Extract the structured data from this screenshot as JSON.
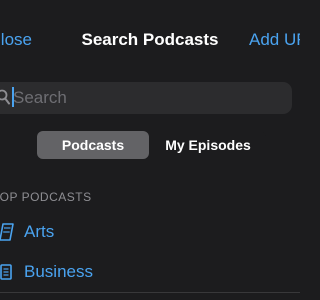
{
  "navbar": {
    "left_label": "Close",
    "title": "Search Podcasts",
    "right_label": "Add URL"
  },
  "search": {
    "placeholder": "Search",
    "value": ""
  },
  "segmented": {
    "options": [
      "Podcasts",
      "My Episodes"
    ],
    "selected": "Podcasts"
  },
  "section": {
    "header": "TOP PODCASTS",
    "items": [
      {
        "label": "Arts",
        "icon": "arts-icon"
      },
      {
        "label": "Business",
        "icon": "business-icon"
      }
    ]
  },
  "colors": {
    "background": "#1c1c1e",
    "accent": "#4aa3f0",
    "field": "#2c2c2e",
    "segment_selected": "#636366",
    "secondary_text": "#8e8e93"
  }
}
